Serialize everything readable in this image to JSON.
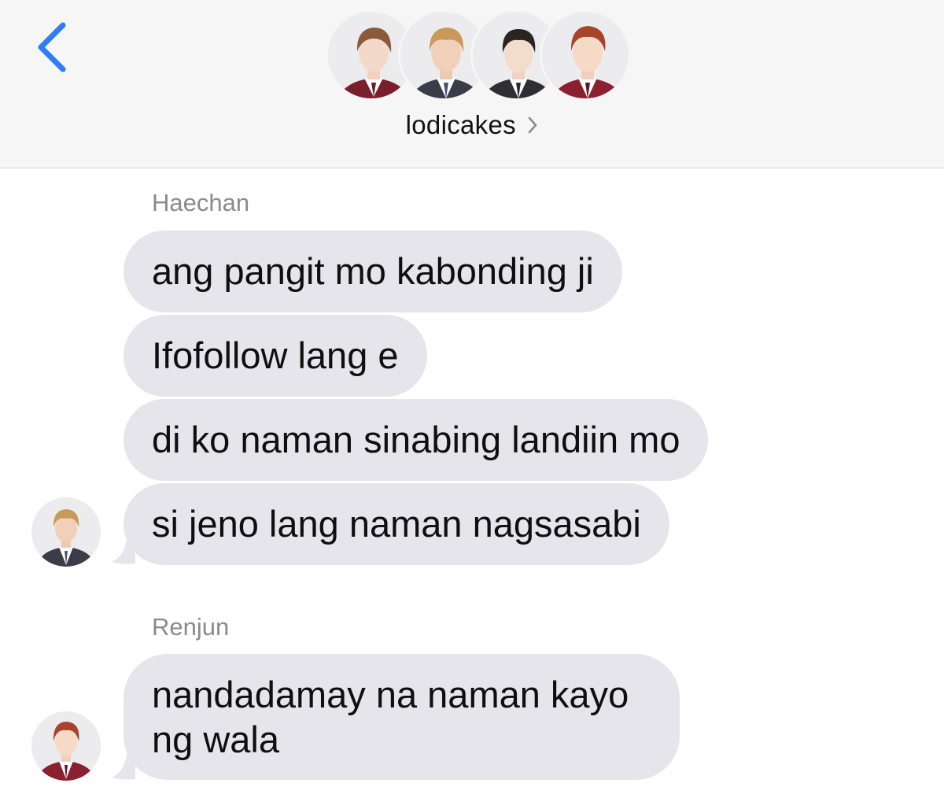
{
  "header": {
    "back_icon": "chevron-left-icon",
    "group_name": "lodicakes",
    "group_chevron_icon": "chevron-right-icon",
    "member_avatars": [
      "avatar-1",
      "avatar-2",
      "avatar-3",
      "avatar-4"
    ]
  },
  "colors": {
    "accent": "#2f7cf6",
    "header_bg": "#f6f6f6",
    "bubble_bg": "#e6e5eb",
    "sender_text": "#8b8b8f"
  },
  "messages": [
    {
      "sender": "Haechan",
      "bubbles": [
        "ang pangit mo kabonding ji",
        "Ifofollow lang e",
        "di ko naman sinabing landiin mo",
        "si jeno lang naman nagsasabi"
      ]
    },
    {
      "sender": "Renjun",
      "bubbles": [
        "nandadamay na naman kayo ng wala"
      ]
    }
  ]
}
